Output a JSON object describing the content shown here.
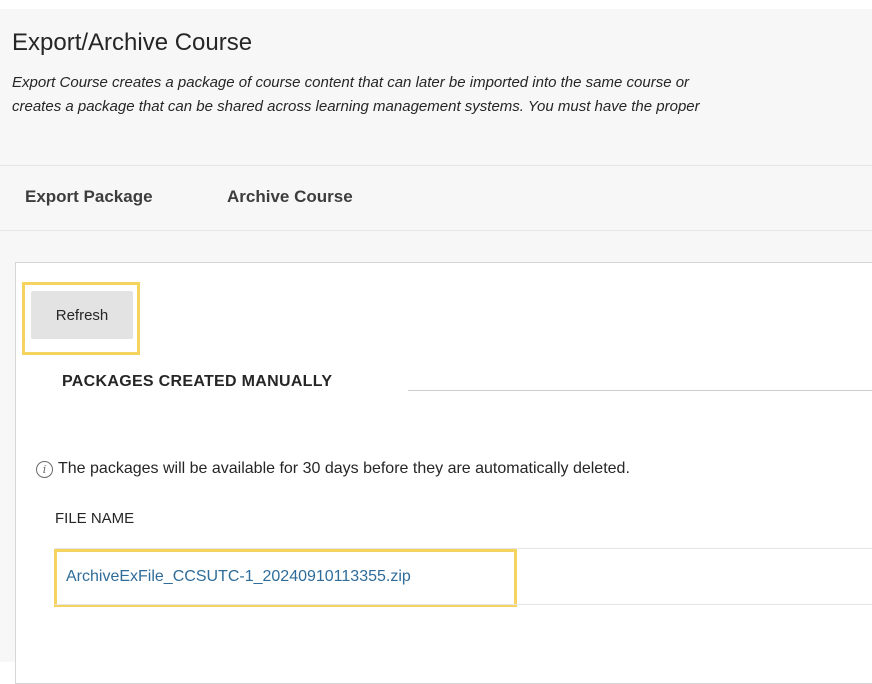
{
  "header": {
    "title": "Export/Archive Course",
    "description_line1": "Export Course creates a package of course content that can later be imported into the same course or",
    "description_line2": "creates a package that can be shared across learning management systems. You must have the proper"
  },
  "tabs": [
    {
      "label": "Export Package"
    },
    {
      "label": "Archive Course"
    }
  ],
  "toolbar": {
    "refresh_label": "Refresh"
  },
  "packages": {
    "heading": "PACKAGES CREATED MANUALLY",
    "info_icon": "info-icon",
    "info_text": "The packages will be available for 30 days before they are automatically deleted.",
    "column_header": "FILE NAME",
    "files": [
      {
        "name": "ArchiveExFile_CCSUTC-1_20240910113355.zip"
      }
    ]
  },
  "colors": {
    "highlight": "#f4d35e",
    "link": "#2f6c99",
    "header_bg": "#f7f7f7",
    "button_bg": "#e3e3e3"
  }
}
